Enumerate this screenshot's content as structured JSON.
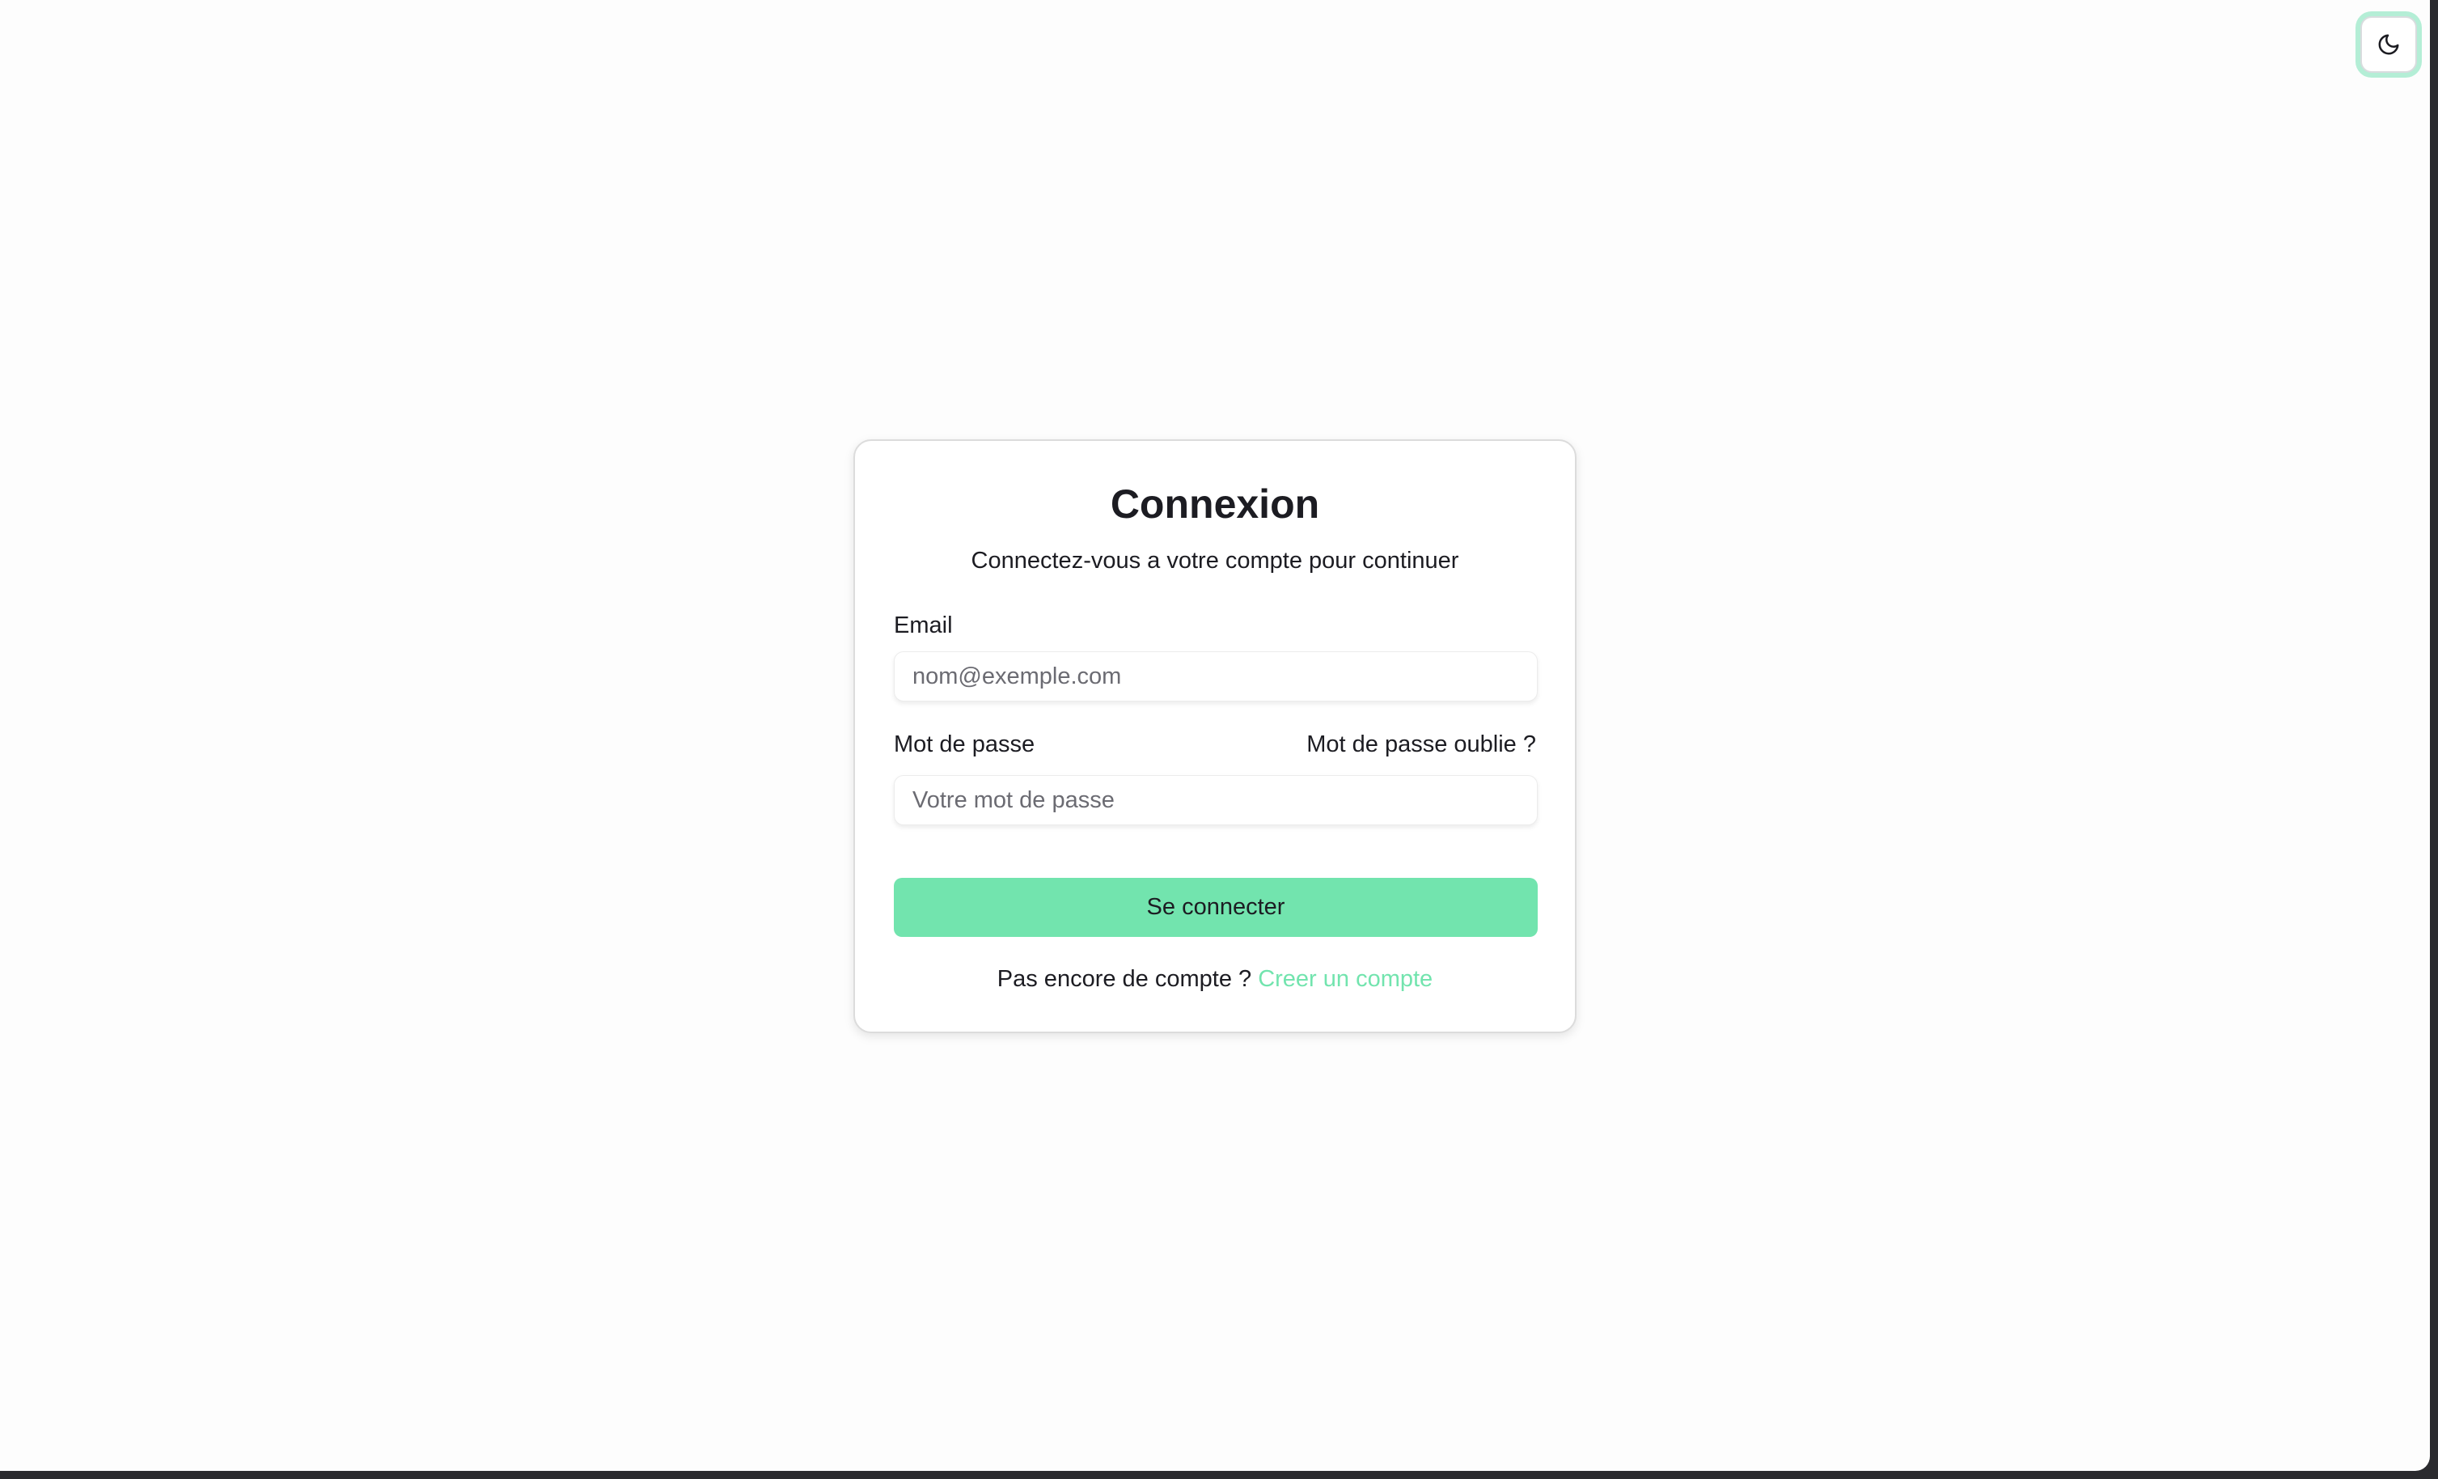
{
  "colors": {
    "accent": "#72e4ae",
    "text": "#1c1c22",
    "page_background": "#fdfdfd"
  },
  "header": {
    "theme_toggle_icon": "moon-icon"
  },
  "login": {
    "title": "Connexion",
    "subtitle": "Connectez-vous a votre compte pour continuer",
    "email": {
      "label": "Email",
      "value": "",
      "placeholder": "nom@exemple.com"
    },
    "password": {
      "label": "Mot de passe",
      "forgot_link": "Mot de passe oublie ?",
      "value": "",
      "placeholder": "Votre mot de passe"
    },
    "submit_label": "Se connecter",
    "signup_prompt": "Pas encore de compte ?",
    "signup_link": "Creer un compte"
  }
}
